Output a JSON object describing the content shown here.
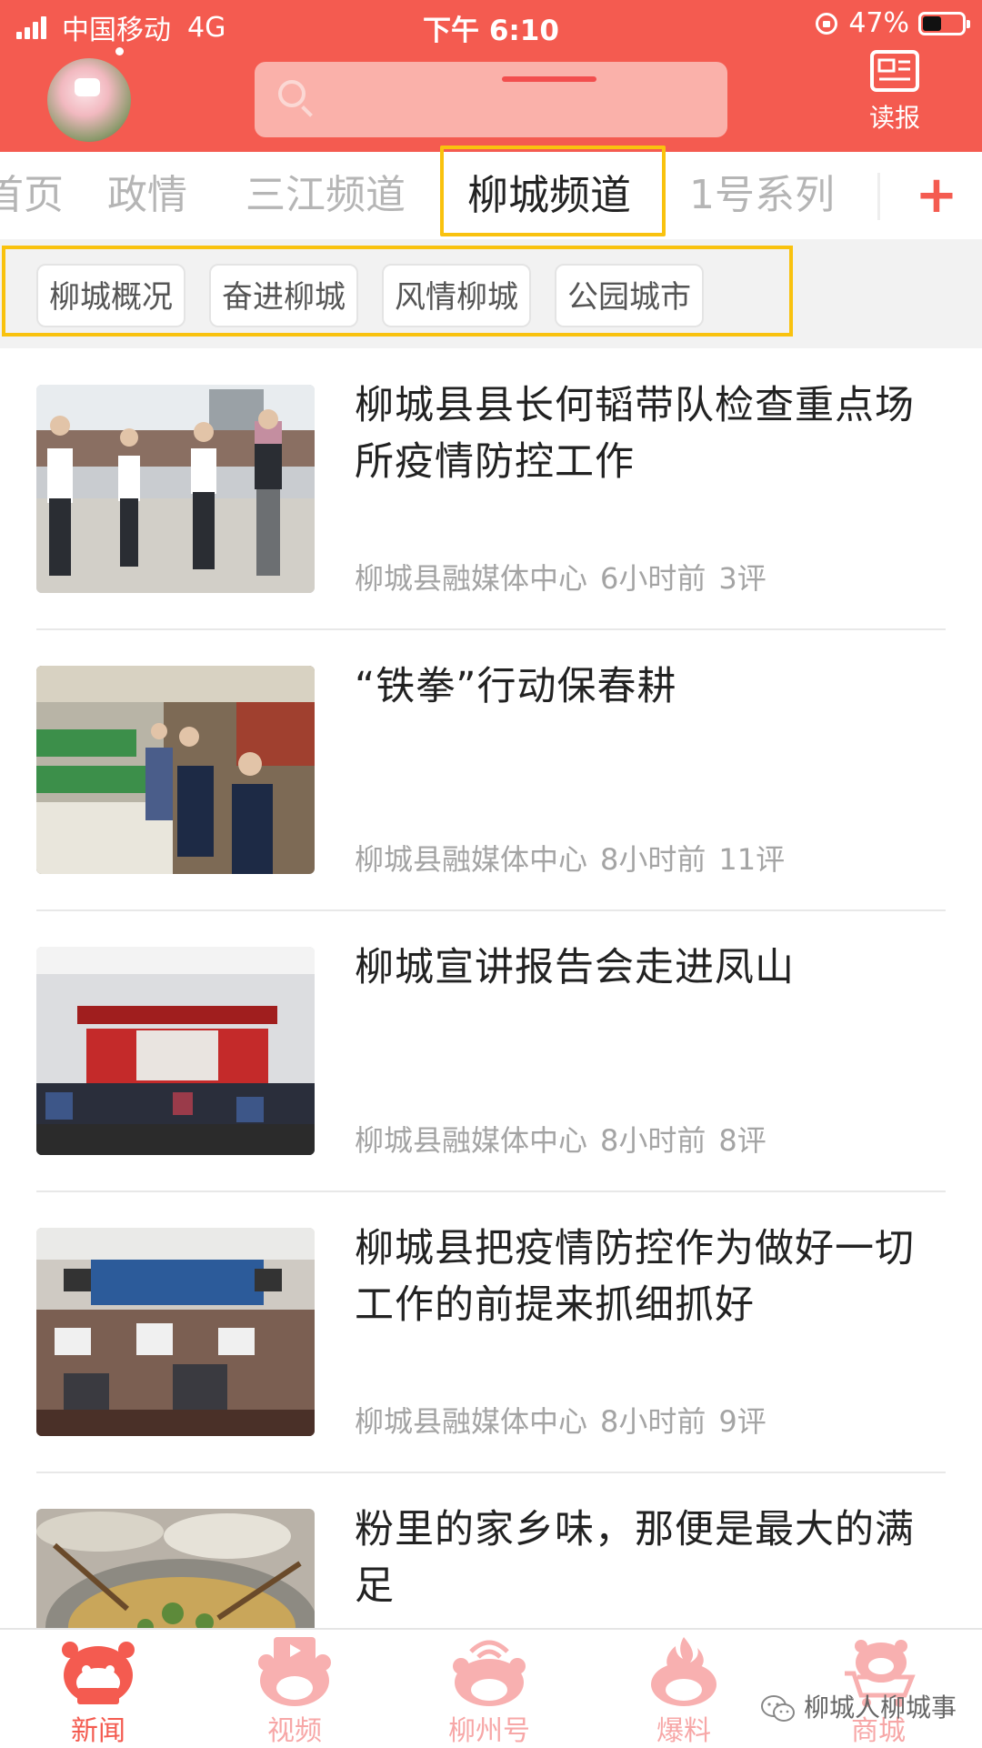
{
  "status_bar": {
    "carrier": "中国移动",
    "network": "4G",
    "time": "下午 6:10",
    "battery": "47%"
  },
  "header": {
    "search_placeholder": "",
    "read_label": "读报"
  },
  "colors": {
    "brand": "#f45b50",
    "highlight": "#f9c20e"
  },
  "tabs": [
    {
      "label": "首页"
    },
    {
      "label": "政情"
    },
    {
      "label": "三江频道"
    },
    {
      "label": "柳城频道"
    },
    {
      "label": "1号系列"
    }
  ],
  "active_tab": "柳城频道",
  "add_tab_label": "+",
  "subcategories": [
    {
      "label": "柳城概况"
    },
    {
      "label": "奋进柳城"
    },
    {
      "label": "风情柳城"
    },
    {
      "label": "公园城市"
    }
  ],
  "news": [
    {
      "title": "柳城县县长何韬带队检查重点场所疫情防控工作",
      "source": "柳城县融媒体中心",
      "time": "6小时前",
      "comments": "3评"
    },
    {
      "title": "“铁拳”行动保春耕",
      "source": "柳城县融媒体中心",
      "time": "8小时前",
      "comments": "11评"
    },
    {
      "title": "柳城宣讲报告会走进凤山",
      "source": "柳城县融媒体中心",
      "time": "8小时前",
      "comments": "8评"
    },
    {
      "title": "柳城县把疫情防控作为做好一切工作的前提来抓细抓好",
      "source": "柳城县融媒体中心",
      "time": "8小时前",
      "comments": "9评"
    },
    {
      "title": "粉里的家乡味，那便是最大的满足",
      "source": "",
      "time": "",
      "comments": ""
    }
  ],
  "bottom_nav": [
    {
      "label": "新闻",
      "icon": "tiger-news-icon"
    },
    {
      "label": "视频",
      "icon": "tiger-video-icon"
    },
    {
      "label": "柳州号",
      "icon": "tiger-broadcast-icon"
    },
    {
      "label": "爆料",
      "icon": "tiger-fire-icon"
    },
    {
      "label": "商城",
      "icon": "tiger-cart-icon"
    }
  ],
  "watermark": "柳城人柳城事"
}
